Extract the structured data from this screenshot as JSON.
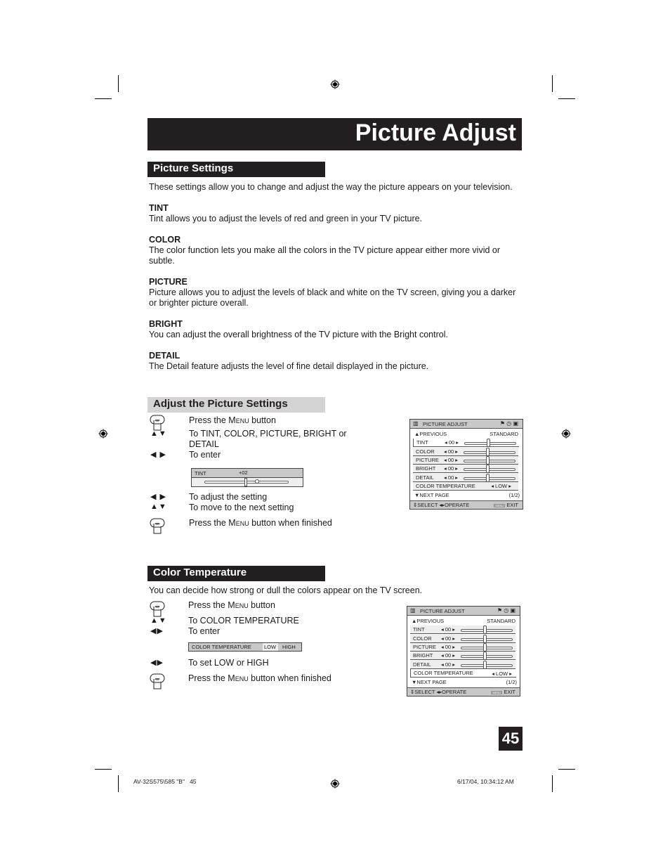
{
  "page": {
    "title": "Picture Adjust",
    "page_number": "45"
  },
  "picture_settings": {
    "heading": "Picture Settings",
    "intro": "These settings allow you to change and adjust the way the picture appears on your television.",
    "items": [
      {
        "label": "TINT",
        "text": "Tint allows you to adjust the levels of red and green in your TV picture."
      },
      {
        "label": "COLOR",
        "text": "The color function lets you make all the colors in the TV picture appear either more vivid or subtle."
      },
      {
        "label": "PICTURE",
        "text": "Picture allows you to adjust the levels of black and white on the TV screen, giving you a darker or brighter picture overall."
      },
      {
        "label": "BRIGHT",
        "text": "You can adjust the overall brightness of the TV picture with the Bright control."
      },
      {
        "label": "DETAIL",
        "text": "The Detail feature adjusts the level of fine detail displayed in the picture."
      }
    ]
  },
  "adjust_section": {
    "heading": "Adjust the Picture Settings",
    "steps": [
      {
        "icon": "menu-hand-icon",
        "pre": "Press the ",
        "sc": "Menu",
        "post": " button"
      },
      {
        "icon": "up-down-arrows-icon",
        "glyph": "▲▼",
        "text": "To TINT, COLOR, PICTURE, BRIGHT or DETAIL"
      },
      {
        "icon": "left-right-arrows-icon",
        "glyph": "◀ ▶",
        "text": "To enter"
      },
      {
        "icon": "left-right-arrows-icon",
        "glyph": "◀ ▶",
        "text": "To adjust the setting"
      },
      {
        "icon": "up-down-arrows-icon",
        "glyph": "▲▼",
        "text": "To move to the next setting"
      },
      {
        "icon": "menu-hand-icon",
        "pre": "Press the ",
        "sc": "Menu",
        "post": " button when finished"
      }
    ],
    "tint_bar": {
      "label": "TINT",
      "value": "+02"
    }
  },
  "color_temp_section": {
    "heading": "Color Temperature",
    "intro": "You can decide how strong or dull the colors appear on the TV screen.",
    "steps": [
      {
        "icon": "menu-hand-icon",
        "pre": "Press the ",
        "sc": "Menu",
        "post": " button"
      },
      {
        "icon": "up-down-arrows-icon",
        "glyph": "▲▼",
        "text": "To COLOR TEMPERATURE"
      },
      {
        "icon": "left-right-arrows-icon",
        "glyph": "◀▶",
        "text": "To enter"
      },
      {
        "icon": "left-right-arrows-icon",
        "glyph": "◀▶",
        "text": "To set LOW or HIGH"
      },
      {
        "icon": "menu-hand-icon",
        "pre": "Press the ",
        "sc": "Menu",
        "post": " button when finished"
      }
    ],
    "ct_bar": {
      "label": "COLOR TEMPERATURE",
      "low": "LOW",
      "high": "HIGH"
    }
  },
  "osd_menu": {
    "title": "PICTURE ADJUST",
    "previous": "▲PREVIOUS",
    "mode": "STANDARD",
    "rows": [
      {
        "label": "TINT",
        "value": "00"
      },
      {
        "label": "COLOR",
        "value": "00"
      },
      {
        "label": "PICTURE",
        "value": "00"
      },
      {
        "label": "BRIGHT",
        "value": "00"
      },
      {
        "label": "DETAIL",
        "value": "00"
      }
    ],
    "color_temp_label": "COLOR TEMPERATURE",
    "color_temp_value": "LOW",
    "next_page": "▼NEXT PAGE",
    "page": "(1/2)",
    "footer_select": "SELECT",
    "footer_operate": "OPERATE",
    "footer_menu": "MENU",
    "footer_exit": "EXIT"
  },
  "footer": {
    "left": "AV-32S575\\585 \"B\"   45",
    "right": "6/17/04, 10:34:12 AM"
  }
}
